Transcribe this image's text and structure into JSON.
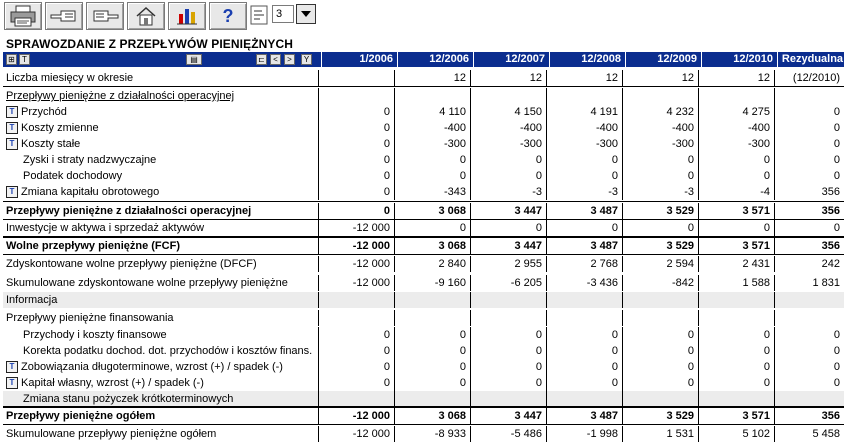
{
  "report": {
    "title": "SPRAWOZDANIE Z PRZEPŁYWÓW PIENIĘŻNYCH"
  },
  "toolbar": {
    "page_value": "3"
  },
  "columns": [
    "1/2006",
    "12/2006",
    "12/2007",
    "12/2008",
    "12/2009",
    "12/2010",
    "Rezydualna"
  ],
  "rows": [
    {
      "label": "Liczba miesięcy w okresie",
      "values": [
        "",
        "12",
        "12",
        "12",
        "12",
        "12",
        "(12/2010)"
      ]
    },
    {
      "label": "Przepływy pieniężne z działalności operacyjnej",
      "values": [
        "",
        "",
        "",
        "",
        "",
        "",
        ""
      ]
    },
    {
      "label": "Przychód",
      "values": [
        "0",
        "4 110",
        "4 150",
        "4 191",
        "4 232",
        "4 275",
        "0"
      ]
    },
    {
      "label": "Koszty zmienne",
      "values": [
        "0",
        "-400",
        "-400",
        "-400",
        "-400",
        "-400",
        "0"
      ]
    },
    {
      "label": "Koszty stałe",
      "values": [
        "0",
        "-300",
        "-300",
        "-300",
        "-300",
        "-300",
        "0"
      ]
    },
    {
      "label": "Zyski i straty nadzwyczajne",
      "values": [
        "0",
        "0",
        "0",
        "0",
        "0",
        "0",
        "0"
      ]
    },
    {
      "label": "Podatek dochodowy",
      "values": [
        "0",
        "0",
        "0",
        "0",
        "0",
        "0",
        "0"
      ]
    },
    {
      "label": "Zmiana kapitału obrotowego",
      "values": [
        "0",
        "-343",
        "-3",
        "-3",
        "-3",
        "-4",
        "356"
      ]
    },
    {
      "label": "Przepływy pieniężne z działalności operacyjnej",
      "values": [
        "0",
        "3 068",
        "3 447",
        "3 487",
        "3 529",
        "3 571",
        "356"
      ]
    },
    {
      "label": "Inwestycje w aktywa i sprzedaż aktywów",
      "values": [
        "-12 000",
        "0",
        "0",
        "0",
        "0",
        "0",
        "0"
      ]
    },
    {
      "label": "Wolne przepływy pieniężne (FCF)",
      "values": [
        "-12 000",
        "3 068",
        "3 447",
        "3 487",
        "3 529",
        "3 571",
        "356"
      ]
    },
    {
      "label": "Zdyskontowane wolne przepływy pieniężne (DFCF)",
      "values": [
        "-12 000",
        "2 840",
        "2 955",
        "2 768",
        "2 594",
        "2 431",
        "242"
      ]
    },
    {
      "label": "Skumulowane zdyskontowane wolne przepływy pieniężne",
      "values": [
        "-12 000",
        "-9 160",
        "-6 205",
        "-3 436",
        "-842",
        "1 588",
        "1 831"
      ]
    },
    {
      "label": "Informacja",
      "values": [
        "",
        "",
        "",
        "",
        "",
        "",
        ""
      ]
    },
    {
      "label": "Przepływy pieniężne finansowania",
      "values": [
        "",
        "",
        "",
        "",
        "",
        "",
        ""
      ]
    },
    {
      "label": "Przychody i koszty finansowe",
      "values": [
        "0",
        "0",
        "0",
        "0",
        "0",
        "0",
        "0"
      ]
    },
    {
      "label": "Korekta podatku dochod. dot. przychodów i kosztów finans.",
      "values": [
        "0",
        "0",
        "0",
        "0",
        "0",
        "0",
        "0"
      ]
    },
    {
      "label": "Zobowiązania długoterminowe, wzrost (+) / spadek (-)",
      "values": [
        "0",
        "0",
        "0",
        "0",
        "0",
        "0",
        "0"
      ]
    },
    {
      "label": "Kapitał własny, wzrost (+) / spadek (-)",
      "values": [
        "0",
        "0",
        "0",
        "0",
        "0",
        "0",
        "0"
      ]
    },
    {
      "label": "Zmiana stanu pożyczek krótkoterminowych",
      "values": [
        "",
        "",
        "",
        "",
        "",
        "",
        ""
      ]
    },
    {
      "label": "Przepływy pieniężne ogółem",
      "values": [
        "-12 000",
        "3 068",
        "3 447",
        "3 487",
        "3 529",
        "3 571",
        "356"
      ]
    },
    {
      "label": "Skumulowane przepływy pieniężne ogółem",
      "values": [
        "-12 000",
        "-8 933",
        "-5 486",
        "-1 998",
        "1 531",
        "5 102",
        "5 458"
      ]
    }
  ],
  "colors": {
    "header_bg": "#0b2d8f",
    "header_text": "#ffffff",
    "info_row_bg": "#ececec",
    "icon_accent": "#1a3fb0"
  }
}
